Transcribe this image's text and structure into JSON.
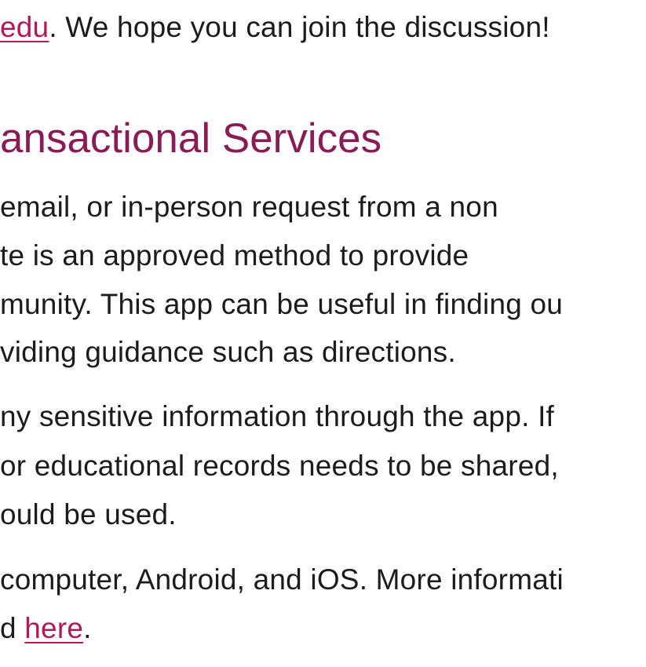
{
  "intro": {
    "link_text": "edu",
    "after_link": ". We hope you can join the discussion!"
  },
  "section": {
    "heading": "ansactional Services",
    "paragraph1": [
      "email, or in-person request from a non",
      "te is an approved method to provide",
      "munity. This app can be useful in finding ou",
      "viding guidance such as directions."
    ],
    "paragraph2": [
      "ny sensitive information through the app. If",
      "or educational records needs to be shared,",
      "ould be used."
    ],
    "paragraph3_line1": "computer, Android, and iOS. More informati",
    "paragraph3_line2_prefix": "d ",
    "paragraph3_link": "here",
    "paragraph3_line2_suffix": "."
  },
  "colors": {
    "link": "#b0195a",
    "heading": "#8a1c55",
    "body_text": "#1c1c1c"
  }
}
